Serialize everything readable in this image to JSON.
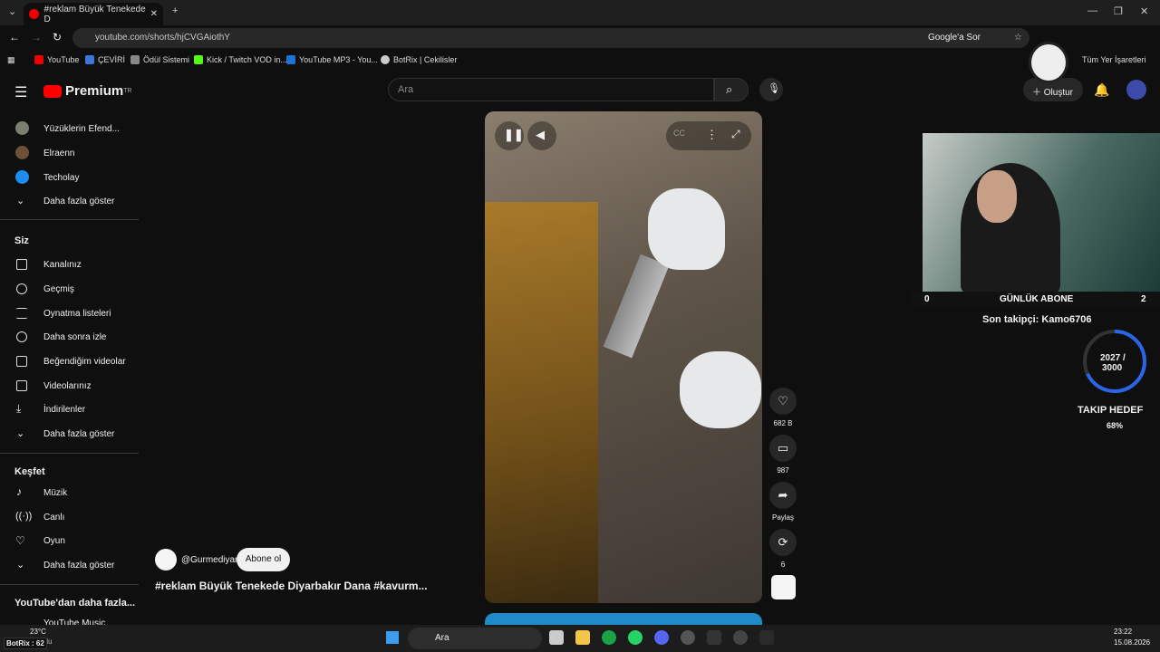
{
  "browser": {
    "tab_title": "#reklam Büyük Tenekede D",
    "url": "youtube.com/shorts/hjCVGAiothY",
    "google_btn": "Google'a Sor",
    "bookmarks": [
      "YouTube",
      "ÇEVİRİ",
      "Ödül Sistemi",
      "Kick / Twitch VOD in...",
      "YouTube MP3 - You...",
      "BotRix | Cekilisler"
    ],
    "all_bookmarks": "Tüm Yer İşaretleri"
  },
  "yt": {
    "brand": "Premium",
    "brand_sup": "TR",
    "search_placeholder": "Ara",
    "create": "Oluştur"
  },
  "sidebar": {
    "subs": [
      "Yüzüklerin Efend...",
      "Elraenn",
      "Techolay"
    ],
    "show_more": "Daha fazla göster",
    "you_head": "Siz",
    "you_items": [
      "Kanalınız",
      "Geçmiş",
      "Oynatma listeleri",
      "Daha sonra izle",
      "Beğendiğim videolar",
      "Videolarınız",
      "İndirilenler",
      "Daha fazla göster"
    ],
    "explore_head": "Keşfet",
    "explore_items": [
      "Müzik",
      "Canlı",
      "Oyun",
      "Daha fazla göster"
    ],
    "more_head": "YouTube'dan daha fazla...",
    "more_item": "YouTube Music"
  },
  "short": {
    "channel": "@Gurmediyar",
    "subscribe": "Abone ol",
    "title": "#reklam Büyük Tenekede Diyarbakır Dana #kavurm...",
    "likes": "682 B",
    "comments": "987",
    "share": "Paylaş",
    "remix": "6"
  },
  "overlay": {
    "gunluk_left": "0",
    "gunluk_label": "GÜNLÜK ABONE",
    "gunluk_right": "2",
    "son_takipci": "Son takipçi: Kamo6706",
    "goal_value": "2027 /",
    "goal_target": "3000",
    "goal_label": "TAKIP HEDEF",
    "goal_pct": "68%",
    "goal_fraction": 0.68
  },
  "taskbar": {
    "weather": "23°C",
    "weather_sub": "Bulutlu",
    "search": "Ara",
    "time": "23:22",
    "date": "15.08.2026",
    "botrix": "BotRix : 62"
  }
}
